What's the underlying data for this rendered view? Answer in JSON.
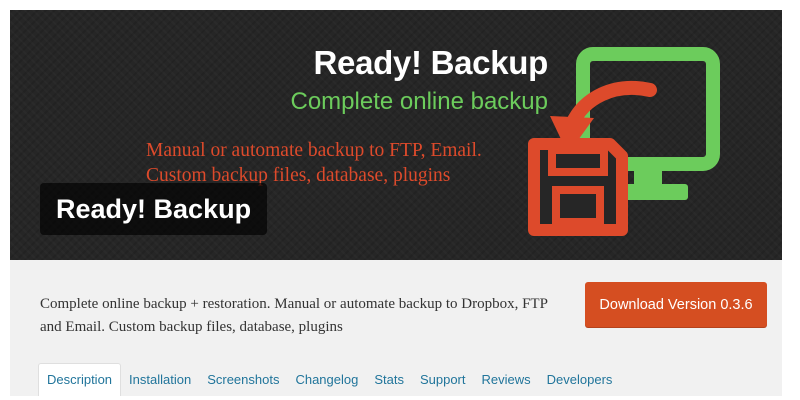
{
  "banner": {
    "title": "Ready! Backup",
    "subtitle": "Complete online backup",
    "features": [
      "Manual or automate backup to FTP, Email.",
      "Custom backup files, database, plugins"
    ],
    "plugin_name": "Ready! Backup",
    "colors": {
      "background": "#262626",
      "subtitle": "#6ccc5c",
      "features": "#dd4a2b",
      "monitor": "#6ccc5c",
      "floppy": "#dd4a2b"
    },
    "logo_icons": [
      "monitor-icon",
      "floppy-disk-icon",
      "curved-arrow-icon"
    ]
  },
  "description": "Complete online backup + restoration. Manual or automate backup to Dropbox, FTP and Email. Custom backup files, database, plugins",
  "download_button": {
    "label": "Download Version 0.3.6",
    "color": "#d54e21"
  },
  "tabs": [
    {
      "label": "Description",
      "active": true
    },
    {
      "label": "Installation",
      "active": false
    },
    {
      "label": "Screenshots",
      "active": false
    },
    {
      "label": "Changelog",
      "active": false
    },
    {
      "label": "Stats",
      "active": false
    },
    {
      "label": "Support",
      "active": false
    },
    {
      "label": "Reviews",
      "active": false
    },
    {
      "label": "Developers",
      "active": false
    }
  ]
}
